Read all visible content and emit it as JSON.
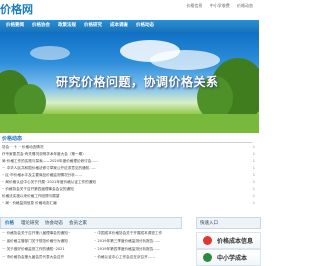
{
  "header": {
    "logo_text": "价格网",
    "links": [
      "价格信息",
      "中小学收费",
      "价格动态"
    ]
  },
  "nav": {
    "items": [
      "价格要闻",
      "价格协会",
      "政策法规",
      "价格研究",
      "成本调查",
      "价格动态"
    ]
  },
  "banner": {
    "slogan": "研究价格问题，协调价格关系"
  },
  "news": {
    "section_title": "价格动态",
    "rows": [
      {
        "title": "协会 ·· 十 ·· 价格动态情况",
        "date": "1"
      },
      {
        "title": "疗专家委员会·有关情况说明学术年度大会（第一期）",
        "date": "1"
      },
      {
        "title": "局·价格工作的实践与探索——2020年度价格理论研讨会……",
        "date": "1"
      },
      {
        "title": "··· 中华人民共和国价格法修订草案公开征求意见的通知……",
        "date": "1"
      },
      {
        "title": "·· 区·市价格水平及主要商品价格监测情况分析……",
        "date": "1"
      },
      {
        "title": "·· 局价格认证中心关于开展··2021年度价格认证工作的通知",
        "date": "1"
      },
      {
        "title": "·· 价格协会关于召开第四届理事会会议的通知",
        "date": "1"
      },
      {
        "title": "价格法实施以来价格工作回顾与展望",
        "date": "1"
      },
      {
        "title": "·· 局·· 价格监测信息 价格动态汇编",
        "date": "1"
      }
    ]
  },
  "tabs": [
    "价格",
    "理论研究",
    "协会动态",
    "会员之家"
  ],
  "list2": {
    "rows": [
      {
        "left": "··· 价格协会关于召开第八届理事会的通知··",
        "right": "·· 中国成本价格协会关于开展成本调查工作"
      },
      {
        "left": "··· 省价格主管部门关于规范价格行为通知",
        "right": "·· 2019年第三季度价格监测分析报告……"
      },
      {
        "left": "··· 关于做好价格监测工作的通知··2021",
        "right": "·· 2019年第四季度价格监测分析报告……"
      },
      {
        "left": "··· 市价格协会第九届会员代表大会召开",
        "right": "·· 价格认证中心工作会议在京召开……"
      }
    ]
  },
  "quick": {
    "title": "快速入口",
    "buttons": [
      {
        "label": "价格成本信息",
        "color": "#e2352d"
      },
      {
        "label": "中小学成本",
        "color": "#2c8a3c"
      }
    ]
  },
  "colors": {
    "nav_bg": "#1a73b8",
    "accent": "#1c7fc4"
  }
}
